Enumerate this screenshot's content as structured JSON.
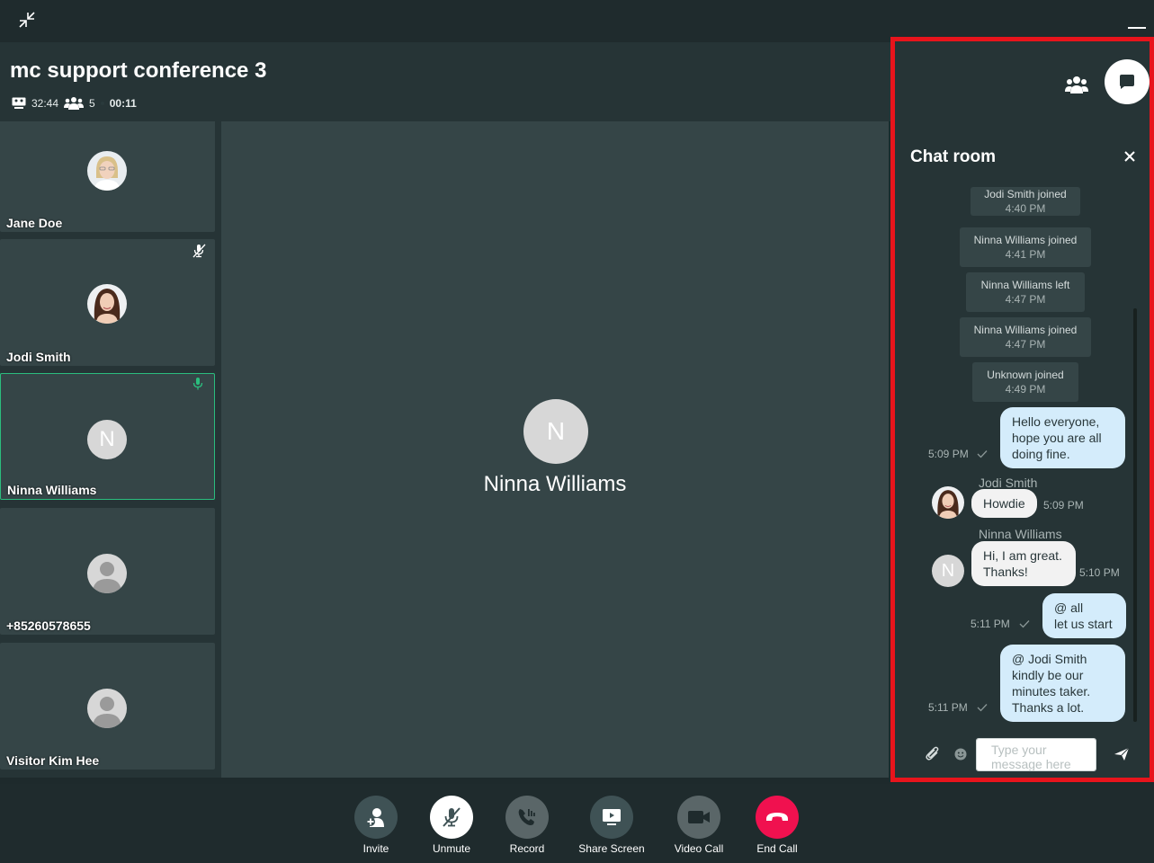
{
  "conference": {
    "title": "mc support conference 3",
    "elapsed": "32:44",
    "participant_count": "5",
    "timer": "00:11"
  },
  "participants": [
    {
      "name": "Jane Doe",
      "avatar": "photo-blonde",
      "mic": "none"
    },
    {
      "name": "Jodi Smith",
      "avatar": "photo-brunette",
      "mic": "muted"
    },
    {
      "name": "Ninna Williams",
      "avatar": "letter",
      "letter": "N",
      "mic": "speaking",
      "active": true
    },
    {
      "name": "+85260578655",
      "avatar": "generic"
    },
    {
      "name": "Visitor Kim Hee",
      "avatar": "generic"
    }
  ],
  "stage": {
    "letter": "N",
    "name": "Ninna Williams"
  },
  "controls": [
    {
      "label": "Invite",
      "icon": "invite-icon"
    },
    {
      "label": "Unmute",
      "icon": "mic-off-icon"
    },
    {
      "label": "Record",
      "icon": "record-icon"
    },
    {
      "label": "Share Screen",
      "icon": "share-screen-icon"
    },
    {
      "label": "Video Call",
      "icon": "video-camera-icon"
    },
    {
      "label": "End Call",
      "icon": "end-call-icon"
    }
  ],
  "chat": {
    "title": "Chat room",
    "system_messages": [
      {
        "text": "Jodi Smith joined",
        "time": "4:40 PM"
      },
      {
        "text": "Ninna Williams joined",
        "time": "4:41 PM"
      },
      {
        "text": "Ninna Williams left",
        "time": "4:47 PM"
      },
      {
        "text": "Ninna Williams joined",
        "time": "4:47 PM"
      },
      {
        "text": "Unknown joined",
        "time": "4:49 PM"
      }
    ],
    "messages": [
      {
        "direction": "out",
        "lines": [
          "Hello everyone,",
          "hope you are all",
          "doing fine."
        ],
        "time": "5:09 PM"
      },
      {
        "direction": "in",
        "sender": "Jodi Smith",
        "lines": [
          "Howdie"
        ],
        "time": "5:09 PM"
      },
      {
        "direction": "in",
        "sender": "Ninna Williams",
        "letter": "N",
        "lines": [
          "Hi, I am great.",
          "Thanks!"
        ],
        "time": "5:10 PM"
      },
      {
        "direction": "out",
        "lines": [
          "@ all",
          "let us start"
        ],
        "time": "5:11 PM"
      },
      {
        "direction": "out",
        "lines": [
          "@ Jodi Smith",
          "kindly be our",
          "minutes taker.",
          "Thanks a lot."
        ],
        "time": "5:11 PM"
      }
    ],
    "composer_placeholder": "Type your message here"
  },
  "colors": {
    "accent_green": "#2bbd7e",
    "end_call_red": "#f0114f",
    "highlight_border": "#e8141c",
    "outgoing_bubble": "#d4ecfb"
  }
}
